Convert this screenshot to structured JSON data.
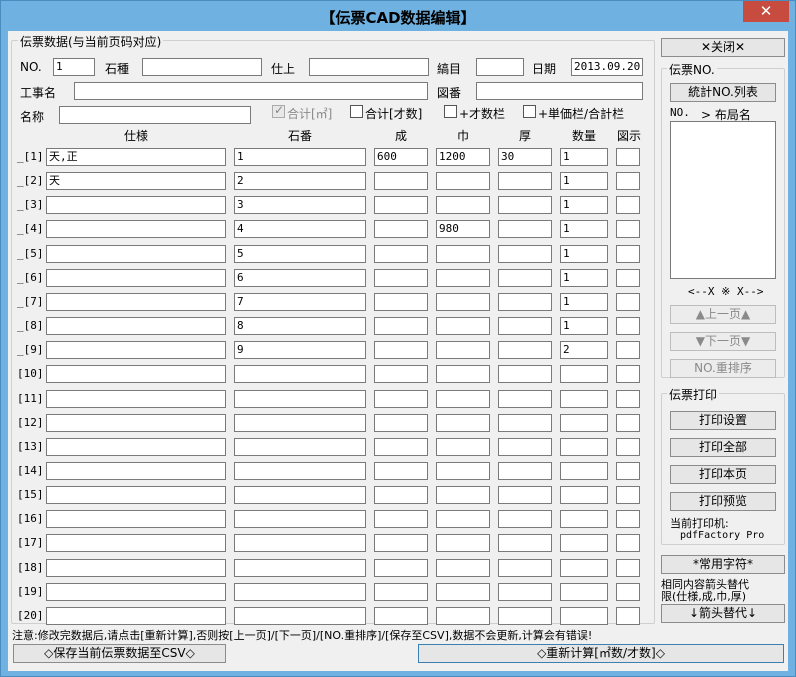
{
  "window": {
    "title": "【伝票CAD数据编辑】",
    "close_glyph": "✕"
  },
  "main_group": {
    "title": "伝票数据(与当前页码对应)"
  },
  "header_fields": {
    "no_label": "NO.",
    "no_value": "1",
    "stone_label": "石種",
    "stone_value": "",
    "finish_label": "仕上",
    "finish_value": "",
    "section_label": "縞目",
    "section_value": "",
    "date_label": "日期",
    "date_value": "2013.09.20",
    "project_label": "工事名",
    "project_value": "",
    "drawing_label": "図番",
    "drawing_value": "",
    "name_label": "名称",
    "name_value": "",
    "chk_total_m2": "合计[㎡]",
    "chk_total_cai": "合计[才数]",
    "chk_cai_col": "+才数栏",
    "chk_price_col": "+単価栏/合計栏"
  },
  "table": {
    "headers": {
      "spec": "仕様",
      "stone_no": "石番",
      "length": "成",
      "width": "巾",
      "thickness": "厚",
      "qty": "数量",
      "figure": "図示"
    },
    "rows": [
      {
        "label": "_[1]",
        "spec": "天,正",
        "stone_no": "1",
        "length": "600",
        "width": "1200",
        "thickness": "30",
        "qty": "1",
        "figure": ""
      },
      {
        "label": "_[2]",
        "spec": "天",
        "stone_no": "2",
        "length": "",
        "width": "",
        "thickness": "",
        "qty": "1",
        "figure": ""
      },
      {
        "label": "_[3]",
        "spec": "",
        "stone_no": "3",
        "length": "",
        "width": "",
        "thickness": "",
        "qty": "1",
        "figure": ""
      },
      {
        "label": "_[4]",
        "spec": "",
        "stone_no": "4",
        "length": "",
        "width": "980",
        "thickness": "",
        "qty": "1",
        "figure": ""
      },
      {
        "label": "_[5]",
        "spec": "",
        "stone_no": "5",
        "length": "",
        "width": "",
        "thickness": "",
        "qty": "1",
        "figure": ""
      },
      {
        "label": "_[6]",
        "spec": "",
        "stone_no": "6",
        "length": "",
        "width": "",
        "thickness": "",
        "qty": "1",
        "figure": ""
      },
      {
        "label": "_[7]",
        "spec": "",
        "stone_no": "7",
        "length": "",
        "width": "",
        "thickness": "",
        "qty": "1",
        "figure": ""
      },
      {
        "label": "_[8]",
        "spec": "",
        "stone_no": "8",
        "length": "",
        "width": "",
        "thickness": "",
        "qty": "1",
        "figure": ""
      },
      {
        "label": "_[9]",
        "spec": "",
        "stone_no": "9",
        "length": "",
        "width": "",
        "thickness": "",
        "qty": "2",
        "figure": ""
      },
      {
        "label": "[10]",
        "spec": "",
        "stone_no": "",
        "length": "",
        "width": "",
        "thickness": "",
        "qty": "",
        "figure": ""
      },
      {
        "label": "[11]",
        "spec": "",
        "stone_no": "",
        "length": "",
        "width": "",
        "thickness": "",
        "qty": "",
        "figure": ""
      },
      {
        "label": "[12]",
        "spec": "",
        "stone_no": "",
        "length": "",
        "width": "",
        "thickness": "",
        "qty": "",
        "figure": ""
      },
      {
        "label": "[13]",
        "spec": "",
        "stone_no": "",
        "length": "",
        "width": "",
        "thickness": "",
        "qty": "",
        "figure": ""
      },
      {
        "label": "[14]",
        "spec": "",
        "stone_no": "",
        "length": "",
        "width": "",
        "thickness": "",
        "qty": "",
        "figure": ""
      },
      {
        "label": "[15]",
        "spec": "",
        "stone_no": "",
        "length": "",
        "width": "",
        "thickness": "",
        "qty": "",
        "figure": ""
      },
      {
        "label": "[16]",
        "spec": "",
        "stone_no": "",
        "length": "",
        "width": "",
        "thickness": "",
        "qty": "",
        "figure": ""
      },
      {
        "label": "[17]",
        "spec": "",
        "stone_no": "",
        "length": "",
        "width": "",
        "thickness": "",
        "qty": "",
        "figure": ""
      },
      {
        "label": "[18]",
        "spec": "",
        "stone_no": "",
        "length": "",
        "width": "",
        "thickness": "",
        "qty": "",
        "figure": ""
      },
      {
        "label": "[19]",
        "spec": "",
        "stone_no": "",
        "length": "",
        "width": "",
        "thickness": "",
        "qty": "",
        "figure": ""
      },
      {
        "label": "[20]",
        "spec": "",
        "stone_no": "",
        "length": "",
        "width": "",
        "thickness": "",
        "qty": "",
        "figure": ""
      }
    ]
  },
  "right_panel": {
    "close_button": "✕关闭✕",
    "slip_group_title": "伝票NO.",
    "stats_button": "統計NO.列表",
    "list_header_no": "NO.",
    "list_header_layout": "> 布局名",
    "x_marker": "<--X ※ X-->",
    "prev_page": "▲上一页▲",
    "next_page": "▼下一页▼",
    "renumber": "NO.重排序",
    "print_group_title": "伝票打印",
    "print_settings": "打印设置",
    "print_all": "打印全部",
    "print_page": "打印本页",
    "print_preview": "打印预览",
    "current_printer_label": "当前打印机:",
    "current_printer_value": "pdfFactory Pro",
    "common_chars": "*常用字符*",
    "arrow_note_line1": "相同内容箭头替代",
    "arrow_note_line2": "限(仕様,成,巾,厚)",
    "arrow_replace": "↓箭头替代↓"
  },
  "footer": {
    "note": "注意:修改完数据后,请点击[重新计算],否则按[上一页]/[下一页]/[NO.重排序]/[保存至CSV],数据不会更新,计算会有错误!",
    "save_csv": "◇保存当前伝票数据至CSV◇",
    "recalc": "◇重新计算[㎡数/才数]◇"
  }
}
